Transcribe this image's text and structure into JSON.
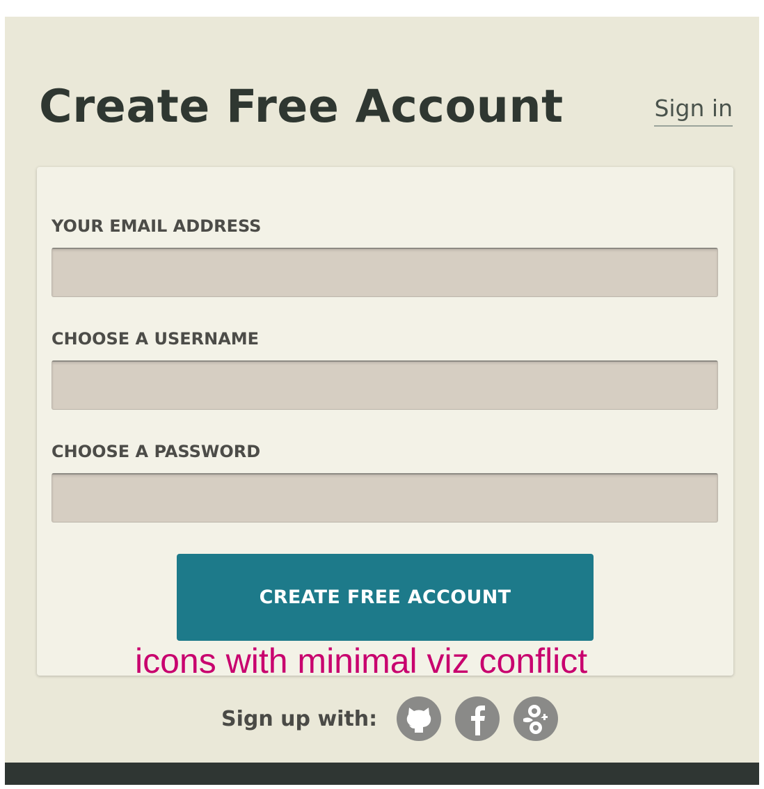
{
  "header": {
    "title": "Create Free Account",
    "signin_label": "Sign in"
  },
  "form": {
    "email_label": "YOUR EMAIL ADDRESS",
    "email_value": "",
    "username_label": "CHOOSE A USERNAME",
    "username_value": "",
    "password_label": "CHOOSE A PASSWORD",
    "password_value": "",
    "submit_label": "CREATE FREE ACCOUNT"
  },
  "annotation": {
    "text": "icons with minimal viz conflict",
    "color": "#c8006e"
  },
  "social": {
    "label": "Sign up with:",
    "providers": [
      {
        "icon": "github-icon"
      },
      {
        "icon": "facebook-icon"
      },
      {
        "icon": "google-icon"
      }
    ],
    "icon_color": "#8a8a88"
  },
  "colors": {
    "background": "#eae8d8",
    "card": "#f3f2e7",
    "input": "#d6cec2",
    "button": "#1d7a8a",
    "footer": "#2f3633"
  }
}
